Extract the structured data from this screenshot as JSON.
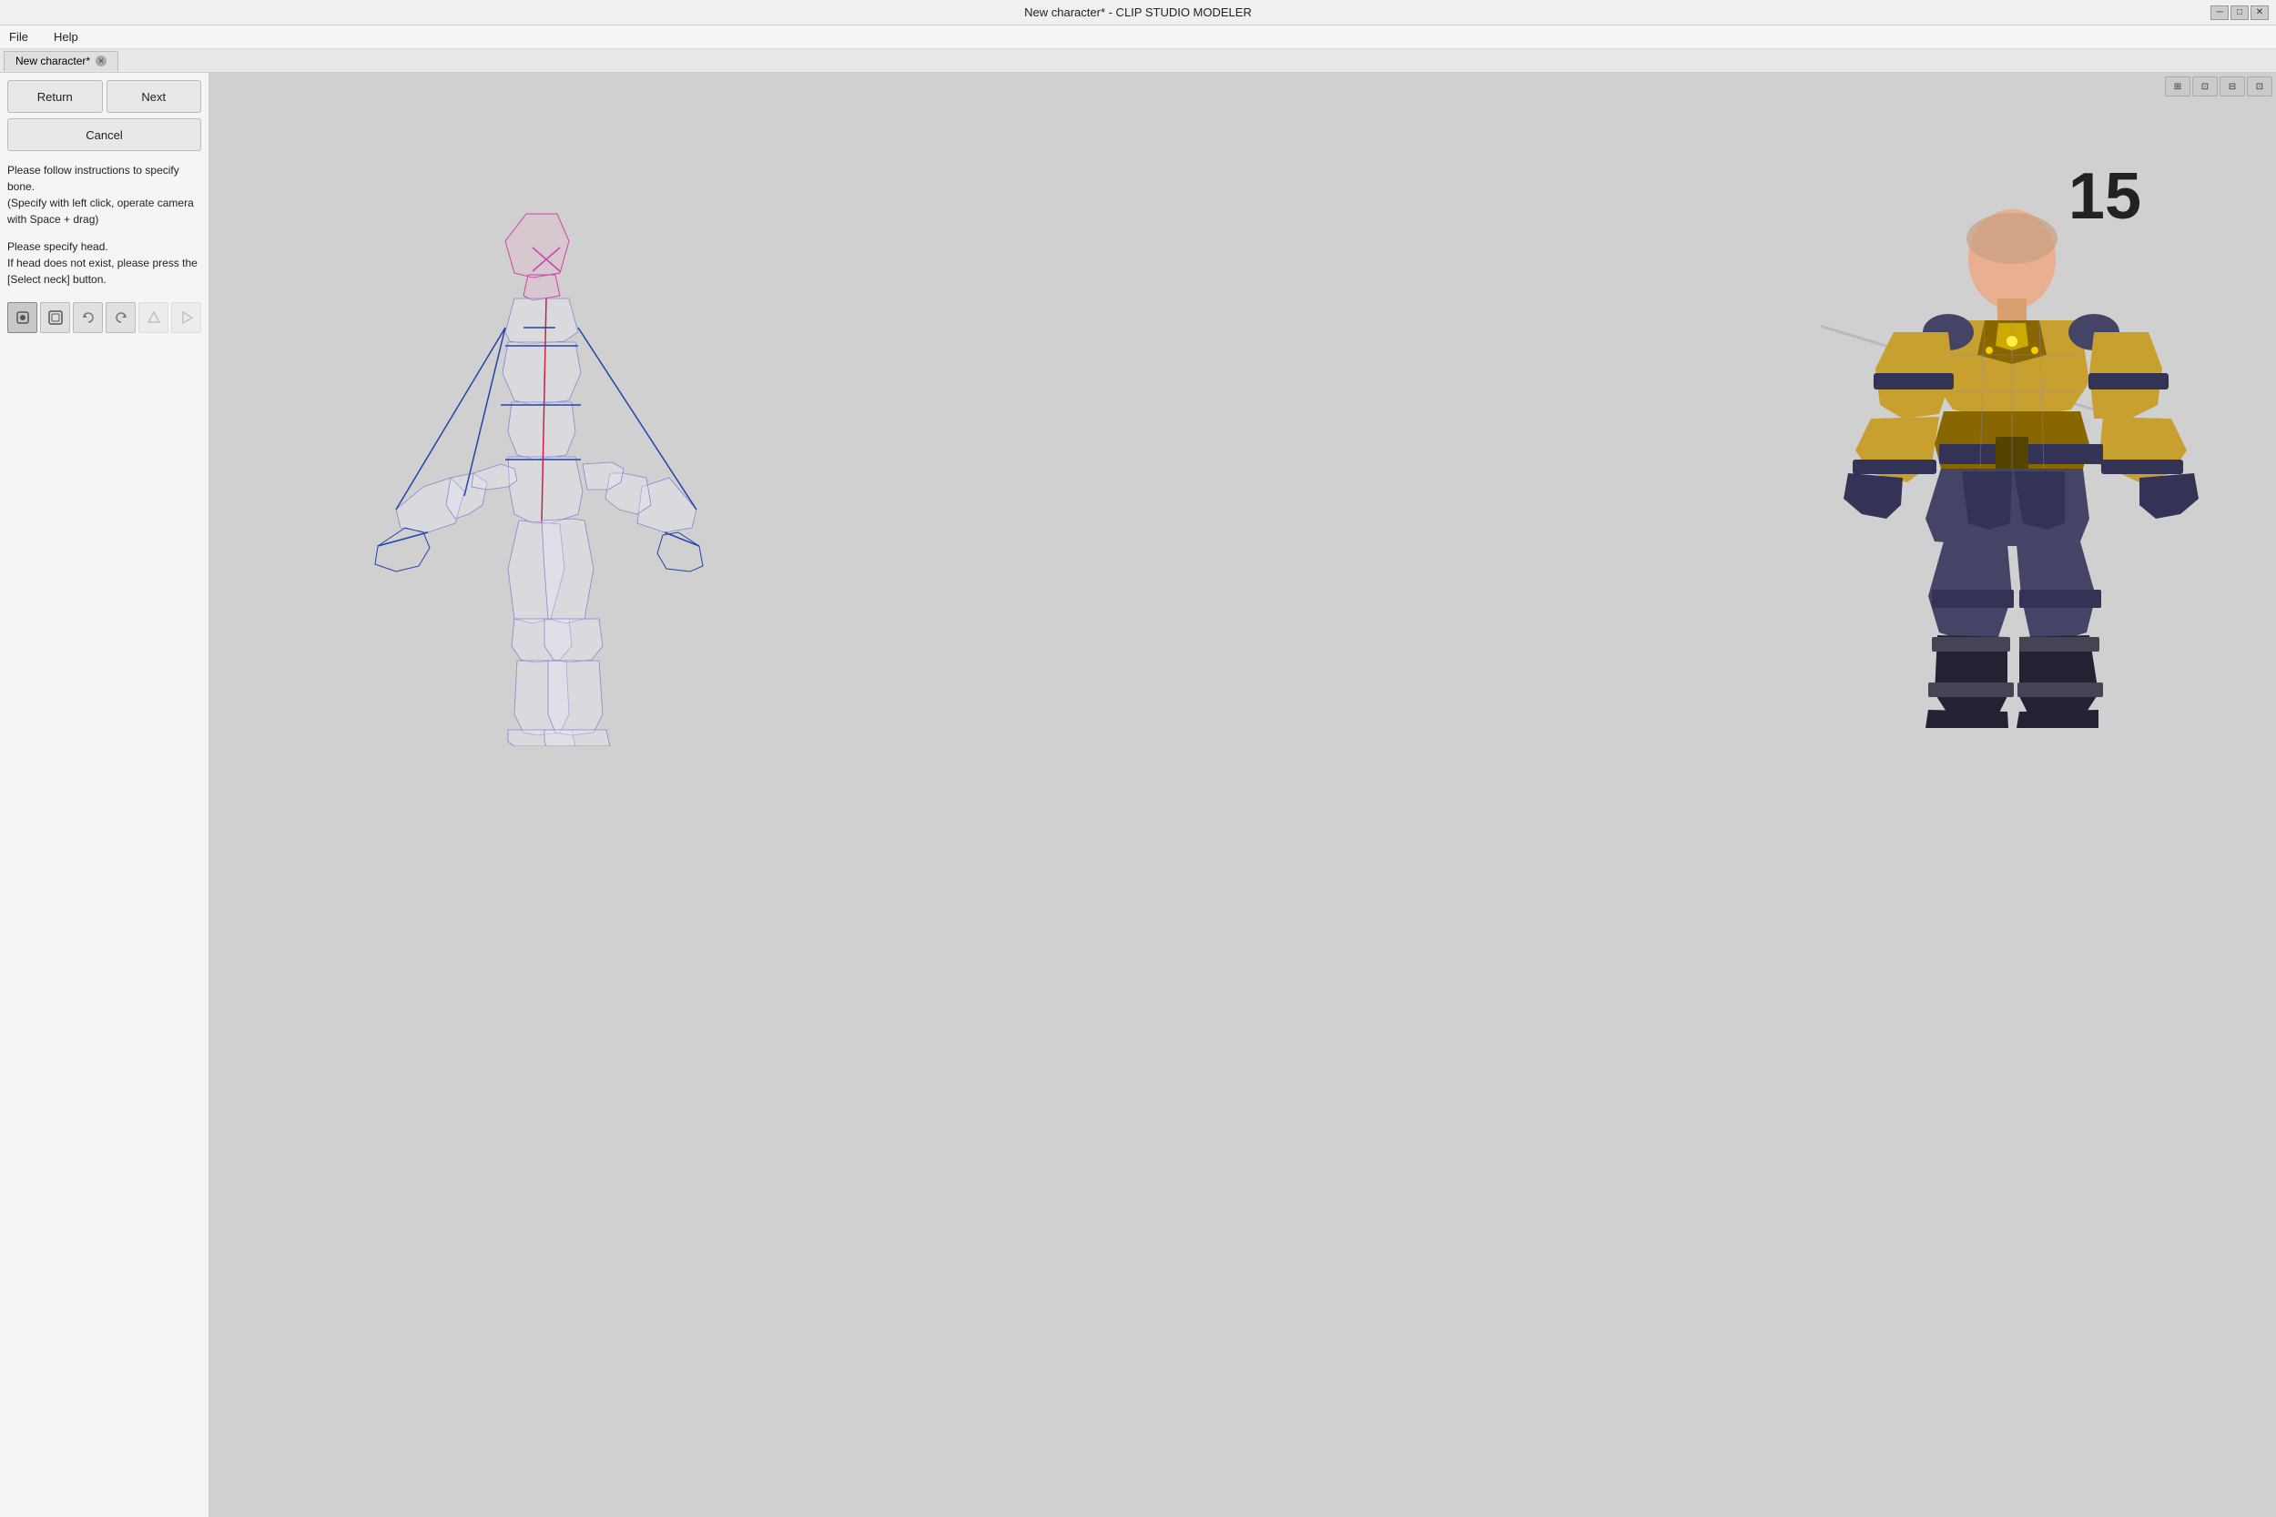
{
  "titlebar": {
    "title": "New character* - CLIP STUDIO MODELER",
    "controls": [
      "minimize",
      "maximize",
      "close"
    ]
  },
  "menubar": {
    "items": [
      "File",
      "Help"
    ]
  },
  "tab": {
    "label": "New character*",
    "has_close": true
  },
  "left_panel": {
    "buttons": {
      "return_label": "Return",
      "next_label": "Next",
      "cancel_label": "Cancel"
    },
    "instructions": {
      "line1": "Please follow instructions to specify bone.",
      "line2": "(Specify with left click, operate camera with Space + drag)",
      "line3": "Please specify head.",
      "line4": "If head does not exist, please press the [Select neck] button."
    },
    "tools": [
      {
        "name": "select-bone-tool",
        "icon": "⊙",
        "active": true
      },
      {
        "name": "select-neck-tool",
        "icon": "⊙",
        "active": false
      },
      {
        "name": "undo-tool",
        "icon": "↺",
        "active": false,
        "disabled": false
      },
      {
        "name": "redo-tool",
        "icon": "↻",
        "active": false,
        "disabled": false
      },
      {
        "name": "tool5",
        "icon": "△",
        "active": false
      },
      {
        "name": "tool6",
        "icon": "▷",
        "active": false
      }
    ]
  },
  "viewport": {
    "toolbar_buttons": [
      "cam1",
      "cam2",
      "fit",
      "grid"
    ],
    "number_badge": "15"
  }
}
